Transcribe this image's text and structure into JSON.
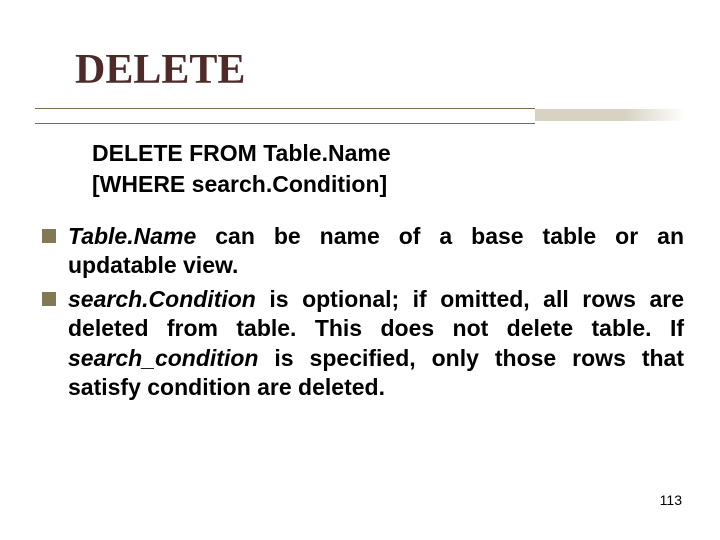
{
  "title": "DELETE",
  "syntax": {
    "line1": "DELETE FROM Table.Name",
    "line2": "[WHERE search.Condition]"
  },
  "bullets": [
    {
      "term": "Table.Name",
      "rest": " can be name of a base table or an updatable view."
    },
    {
      "term": "search.Condition",
      "rest_a": " is optional; if omitted, all rows are deleted from table. This does not delete table. If ",
      "term2": "search_condition",
      "rest_b": " is specified, only those rows that satisfy condition are deleted."
    }
  ],
  "page_number": "113"
}
